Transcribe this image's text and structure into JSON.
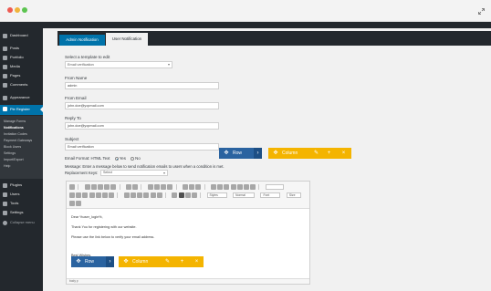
{
  "sidebar": {
    "items": [
      {
        "label": "Dashboard"
      },
      {
        "label": "Posts"
      },
      {
        "label": "Portfolio"
      },
      {
        "label": "Media"
      },
      {
        "label": "Pages"
      },
      {
        "label": "Comments"
      },
      {
        "label": "Appearance"
      },
      {
        "label": "Pie Register"
      },
      {
        "label": "Plugins"
      },
      {
        "label": "Users"
      },
      {
        "label": "Tools"
      },
      {
        "label": "Settings"
      },
      {
        "label": "Collapse menu"
      }
    ],
    "submenu": [
      "Manage Forms",
      "Notifications",
      "Invitation Codes",
      "Payment Gateways",
      "Block Users",
      "Settings",
      "Import/Export",
      "Help"
    ]
  },
  "tabs": [
    {
      "label": "Admin Notification"
    },
    {
      "label": "User Notification"
    }
  ],
  "form": {
    "template_label": "Select a template to edit",
    "template_value": "Email verification",
    "from_name_label": "From Name",
    "from_name_value": "admin",
    "from_email_label": "From Email",
    "from_email_value": "john.doe@yopmail.com",
    "reply_to_label": "Reply To",
    "reply_to_value": "john.doe@yopmail.com",
    "subject_label": "Subject",
    "subject_value": "Email verification",
    "format_label": "Email Format: HTML Text",
    "format_yes": "Yes",
    "format_no": "No",
    "message_desc": "Message: Enter a message below to send notification emails to users when a condition is met.",
    "keys_label": "Replacement Keys:",
    "keys_value": "Select"
  },
  "editor": {
    "combos": [
      "Styles",
      "Normal",
      "Font",
      "Size"
    ],
    "lines": [
      "Dear %user_login%,",
      "Thank You for registering with our website.",
      "Please use the link below to verify your email address.",
      "Best Wishes,",
      "Team %blogname%"
    ],
    "status": "body  p"
  },
  "builder": {
    "row_label": "Row",
    "column_label": "Column"
  }
}
